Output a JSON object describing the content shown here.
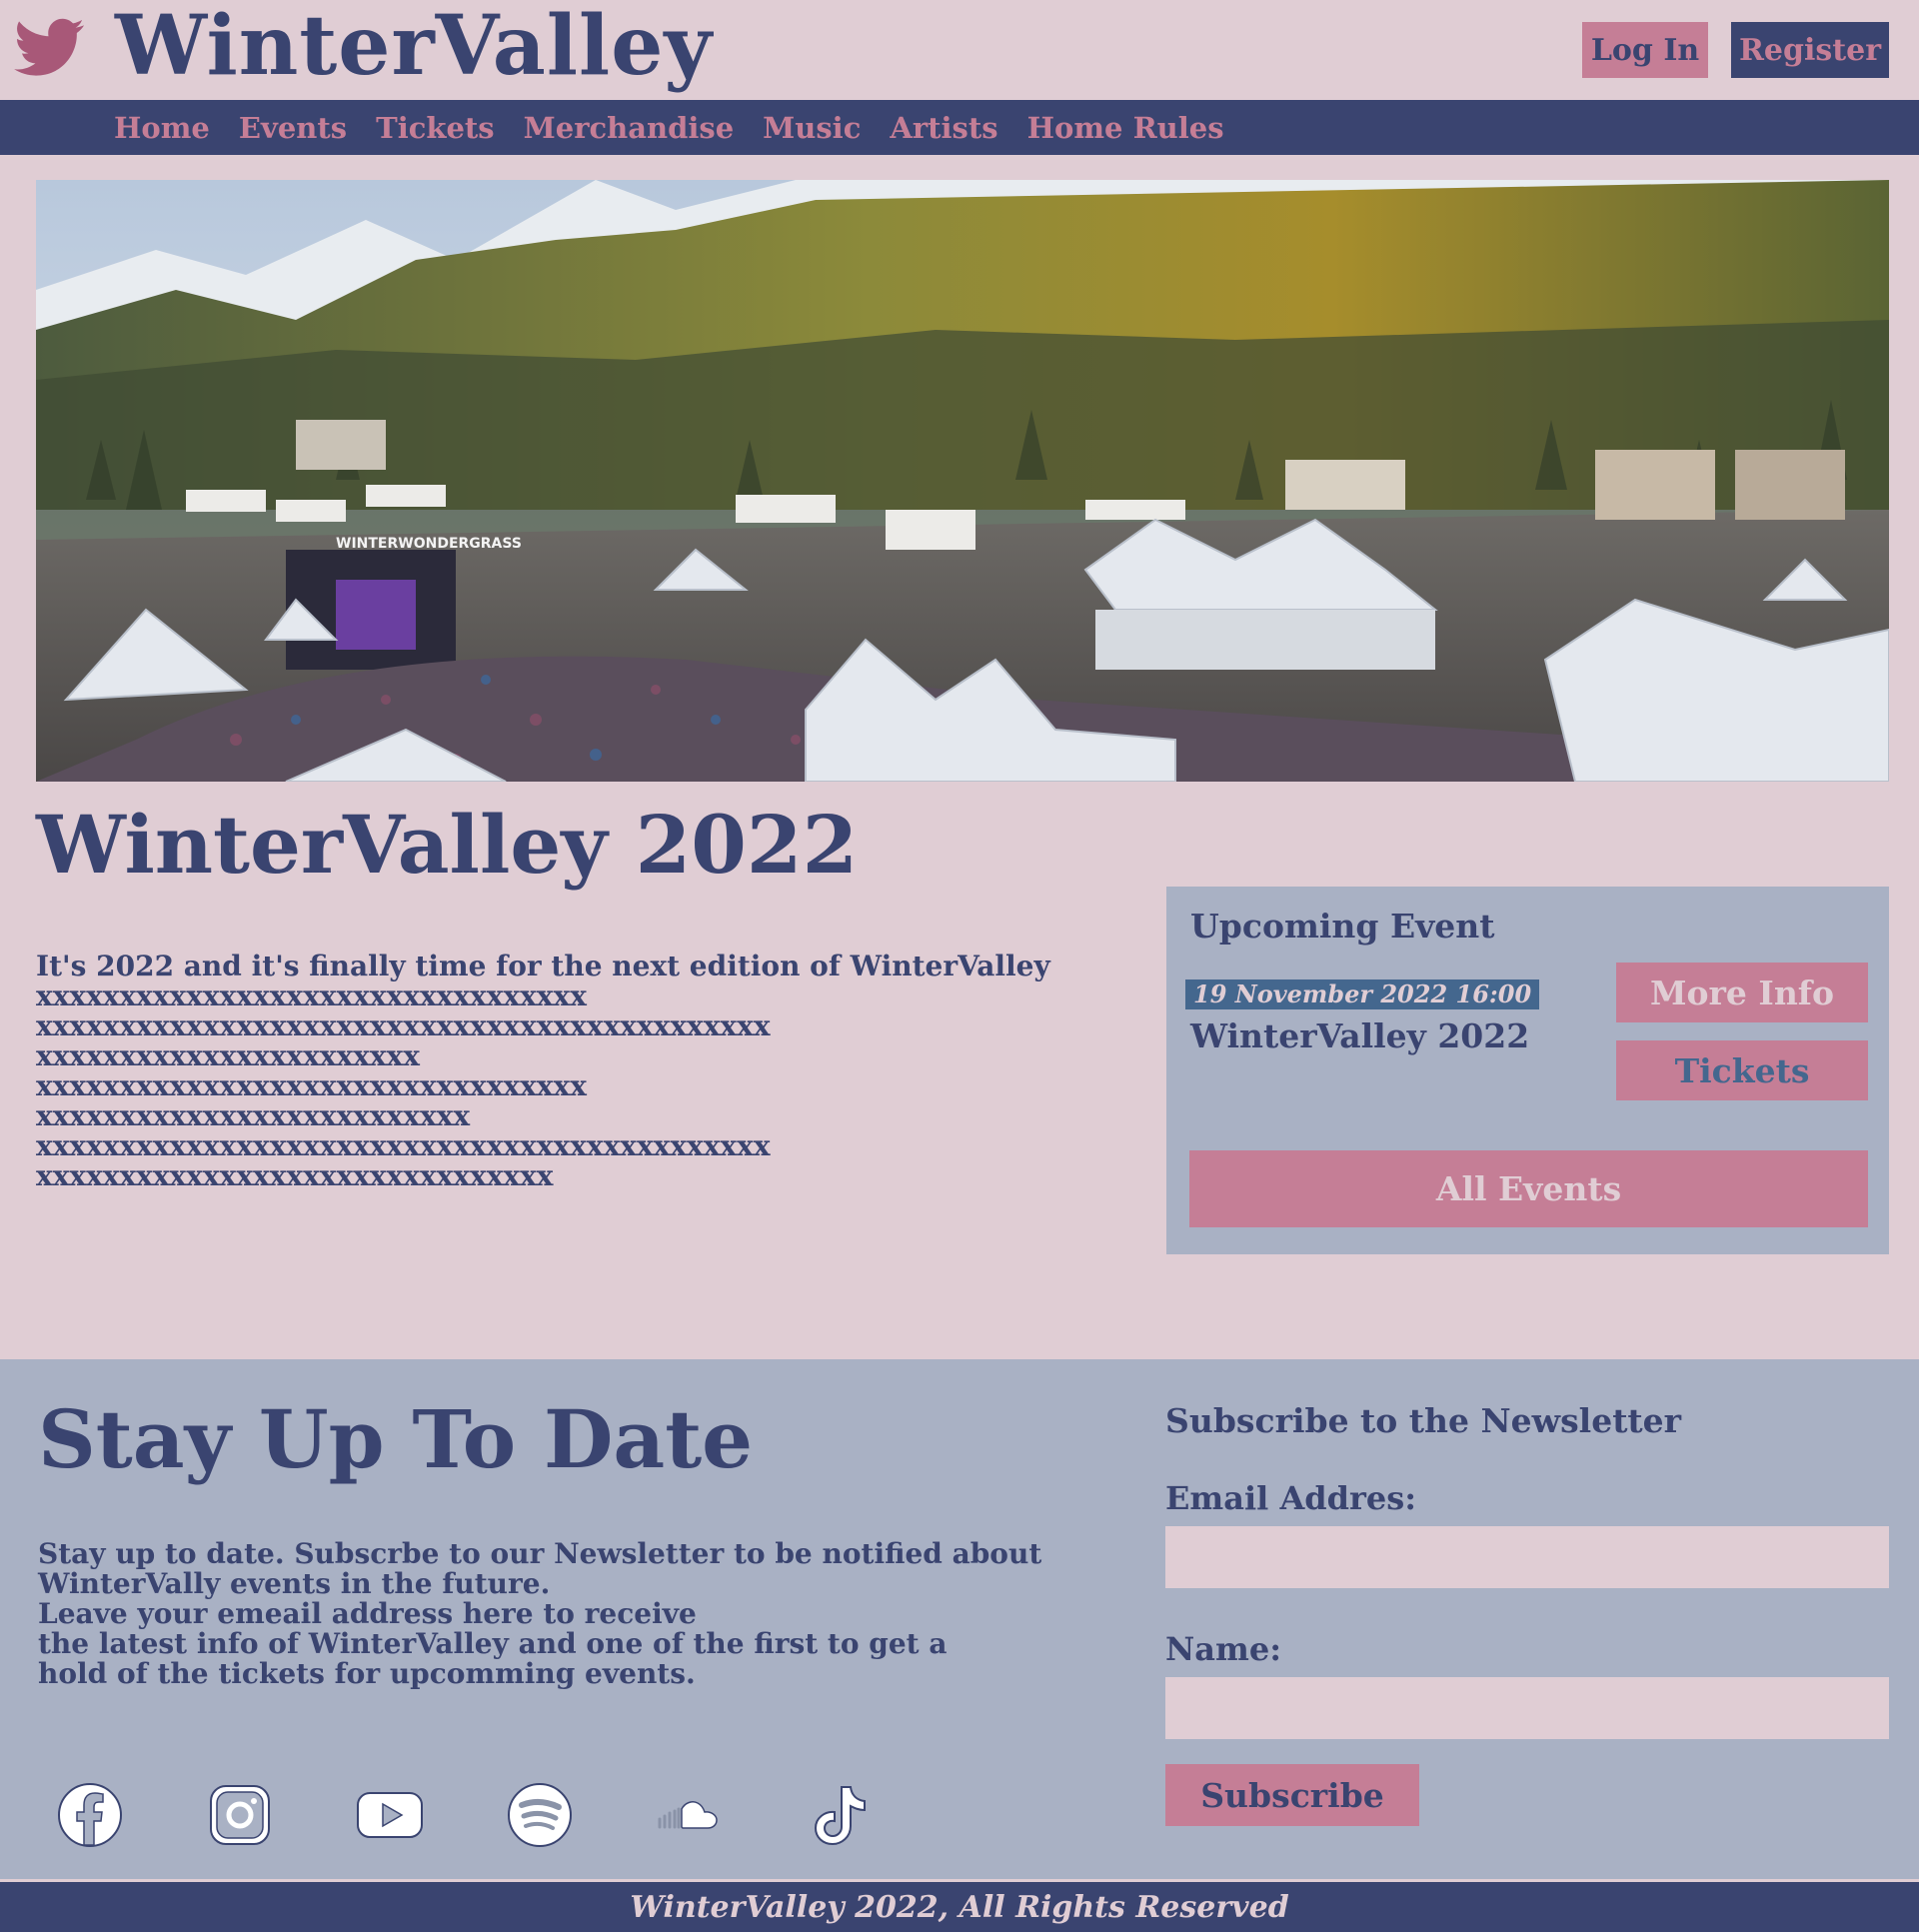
{
  "header": {
    "brand": "WinterValley",
    "logo_icon": "bird-icon",
    "login_label": "Log In",
    "register_label": "Register"
  },
  "nav": {
    "items": [
      "Home",
      "Events",
      "Tickets",
      "Merchandise",
      "Music",
      "Artists",
      "Home Rules"
    ]
  },
  "hero": {
    "image_text": "WINTERWONDERGRASS"
  },
  "main": {
    "title": "WinterValley 2022",
    "intro_lines": [
      "It's 2022 and it's finally time for the next edition of WinterValley",
      "xxxxxxxxxxxxxxxxxxxxxxxxxxxxxxxxx",
      "xxxxxxxxxxxxxxxxxxxxxxxxxxxxxxxxxxxxxxxxxxxx",
      "xxxxxxxxxxxxxxxxxxxxxxx",
      "xxxxxxxxxxxxxxxxxxxxxxxxxxxxxxxxx",
      "xxxxxxxxxxxxxxxxxxxxxxxxxx",
      "xxxxxxxxxxxxxxxxxxxxxxxxxxxxxxxxxxxxxxxxxxxx",
      "xxxxxxxxxxxxxxxxxxxxxxxxxxxxxxx"
    ]
  },
  "event_panel": {
    "heading": "Upcoming Event",
    "date": "19 November 2022 16:00",
    "name": "WinterValley 2022",
    "more_info_label": "More Info",
    "tickets_label": "Tickets",
    "all_events_label": "All Events"
  },
  "newsletter": {
    "title": "Stay Up To Date",
    "text_lines": [
      "Stay up to date. Subscrbe to our Newsletter to be notified about",
      "WinterVally events in the future.",
      "Leave your emeail address here to receive",
      "the latest info of WinterValley and one of the first to get a",
      "hold of the tickets for upcomming events."
    ],
    "subscribe_heading": "Subscribe to the Newsletter",
    "email_label": "Email Addres:",
    "name_label": "Name:",
    "email_value": "",
    "name_value": "",
    "subscribe_label": "Subscribe",
    "socials": [
      "facebook-icon",
      "instagram-icon",
      "youtube-icon",
      "spotify-icon",
      "soundcloud-icon",
      "tiktok-icon"
    ]
  },
  "footer": {
    "text": "WinterValley 2022, All Rights Reserved"
  },
  "colors": {
    "background": "#e0cdd4",
    "navy": "#3a4470",
    "pink": "#c57e96",
    "panel": "#a9b1c4",
    "date_badge": "#44678e"
  }
}
